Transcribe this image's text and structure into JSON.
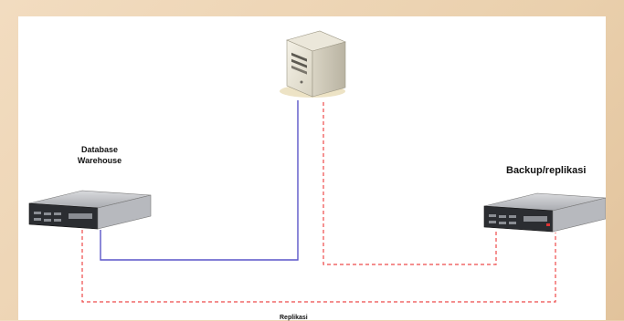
{
  "labels": {
    "db_line1": "Database",
    "db_line2": "Warehouse",
    "backup": "Backup/replikasi",
    "bottom": "Replikasi"
  },
  "icons": {
    "top": "server-tower-icon",
    "left": "rack-server-icon",
    "right": "rack-server-icon"
  },
  "colors": {
    "solid_link": "#5a55c8",
    "dashed_link": "#ee4a4a",
    "background": "#f2dcc0"
  }
}
